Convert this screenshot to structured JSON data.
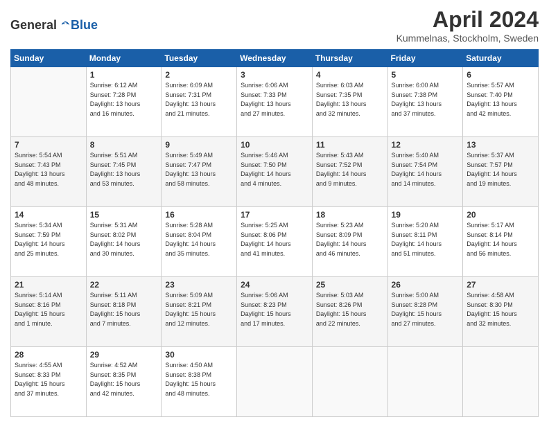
{
  "header": {
    "logo_general": "General",
    "logo_blue": "Blue",
    "month_title": "April 2024",
    "location": "Kummelnas, Stockholm, Sweden"
  },
  "days_of_week": [
    "Sunday",
    "Monday",
    "Tuesday",
    "Wednesday",
    "Thursday",
    "Friday",
    "Saturday"
  ],
  "weeks": [
    [
      {
        "day": "",
        "info": ""
      },
      {
        "day": "1",
        "info": "Sunrise: 6:12 AM\nSunset: 7:28 PM\nDaylight: 13 hours\nand 16 minutes."
      },
      {
        "day": "2",
        "info": "Sunrise: 6:09 AM\nSunset: 7:31 PM\nDaylight: 13 hours\nand 21 minutes."
      },
      {
        "day": "3",
        "info": "Sunrise: 6:06 AM\nSunset: 7:33 PM\nDaylight: 13 hours\nand 27 minutes."
      },
      {
        "day": "4",
        "info": "Sunrise: 6:03 AM\nSunset: 7:35 PM\nDaylight: 13 hours\nand 32 minutes."
      },
      {
        "day": "5",
        "info": "Sunrise: 6:00 AM\nSunset: 7:38 PM\nDaylight: 13 hours\nand 37 minutes."
      },
      {
        "day": "6",
        "info": "Sunrise: 5:57 AM\nSunset: 7:40 PM\nDaylight: 13 hours\nand 42 minutes."
      }
    ],
    [
      {
        "day": "7",
        "info": "Sunrise: 5:54 AM\nSunset: 7:43 PM\nDaylight: 13 hours\nand 48 minutes."
      },
      {
        "day": "8",
        "info": "Sunrise: 5:51 AM\nSunset: 7:45 PM\nDaylight: 13 hours\nand 53 minutes."
      },
      {
        "day": "9",
        "info": "Sunrise: 5:49 AM\nSunset: 7:47 PM\nDaylight: 13 hours\nand 58 minutes."
      },
      {
        "day": "10",
        "info": "Sunrise: 5:46 AM\nSunset: 7:50 PM\nDaylight: 14 hours\nand 4 minutes."
      },
      {
        "day": "11",
        "info": "Sunrise: 5:43 AM\nSunset: 7:52 PM\nDaylight: 14 hours\nand 9 minutes."
      },
      {
        "day": "12",
        "info": "Sunrise: 5:40 AM\nSunset: 7:54 PM\nDaylight: 14 hours\nand 14 minutes."
      },
      {
        "day": "13",
        "info": "Sunrise: 5:37 AM\nSunset: 7:57 PM\nDaylight: 14 hours\nand 19 minutes."
      }
    ],
    [
      {
        "day": "14",
        "info": "Sunrise: 5:34 AM\nSunset: 7:59 PM\nDaylight: 14 hours\nand 25 minutes."
      },
      {
        "day": "15",
        "info": "Sunrise: 5:31 AM\nSunset: 8:02 PM\nDaylight: 14 hours\nand 30 minutes."
      },
      {
        "day": "16",
        "info": "Sunrise: 5:28 AM\nSunset: 8:04 PM\nDaylight: 14 hours\nand 35 minutes."
      },
      {
        "day": "17",
        "info": "Sunrise: 5:25 AM\nSunset: 8:06 PM\nDaylight: 14 hours\nand 41 minutes."
      },
      {
        "day": "18",
        "info": "Sunrise: 5:23 AM\nSunset: 8:09 PM\nDaylight: 14 hours\nand 46 minutes."
      },
      {
        "day": "19",
        "info": "Sunrise: 5:20 AM\nSunset: 8:11 PM\nDaylight: 14 hours\nand 51 minutes."
      },
      {
        "day": "20",
        "info": "Sunrise: 5:17 AM\nSunset: 8:14 PM\nDaylight: 14 hours\nand 56 minutes."
      }
    ],
    [
      {
        "day": "21",
        "info": "Sunrise: 5:14 AM\nSunset: 8:16 PM\nDaylight: 15 hours\nand 1 minute."
      },
      {
        "day": "22",
        "info": "Sunrise: 5:11 AM\nSunset: 8:18 PM\nDaylight: 15 hours\nand 7 minutes."
      },
      {
        "day": "23",
        "info": "Sunrise: 5:09 AM\nSunset: 8:21 PM\nDaylight: 15 hours\nand 12 minutes."
      },
      {
        "day": "24",
        "info": "Sunrise: 5:06 AM\nSunset: 8:23 PM\nDaylight: 15 hours\nand 17 minutes."
      },
      {
        "day": "25",
        "info": "Sunrise: 5:03 AM\nSunset: 8:26 PM\nDaylight: 15 hours\nand 22 minutes."
      },
      {
        "day": "26",
        "info": "Sunrise: 5:00 AM\nSunset: 8:28 PM\nDaylight: 15 hours\nand 27 minutes."
      },
      {
        "day": "27",
        "info": "Sunrise: 4:58 AM\nSunset: 8:30 PM\nDaylight: 15 hours\nand 32 minutes."
      }
    ],
    [
      {
        "day": "28",
        "info": "Sunrise: 4:55 AM\nSunset: 8:33 PM\nDaylight: 15 hours\nand 37 minutes."
      },
      {
        "day": "29",
        "info": "Sunrise: 4:52 AM\nSunset: 8:35 PM\nDaylight: 15 hours\nand 42 minutes."
      },
      {
        "day": "30",
        "info": "Sunrise: 4:50 AM\nSunset: 8:38 PM\nDaylight: 15 hours\nand 48 minutes."
      },
      {
        "day": "",
        "info": ""
      },
      {
        "day": "",
        "info": ""
      },
      {
        "day": "",
        "info": ""
      },
      {
        "day": "",
        "info": ""
      }
    ]
  ]
}
